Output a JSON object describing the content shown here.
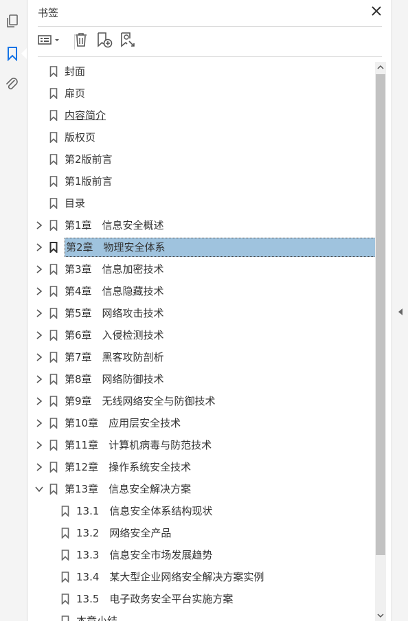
{
  "panel": {
    "title": "书签"
  },
  "toolbar": {
    "items": [
      {
        "name": "options-menu",
        "icon": "list-options-icon"
      },
      {
        "name": "delete",
        "icon": "trash-icon"
      },
      {
        "name": "new-bookmark",
        "icon": "bookmark-add-icon"
      },
      {
        "name": "find-bookmark",
        "icon": "bookmark-search-icon"
      }
    ]
  },
  "left_rail": {
    "items": [
      {
        "name": "pages",
        "icon": "pages-icon"
      },
      {
        "name": "bookmarks",
        "icon": "bookmark-icon",
        "active": true
      },
      {
        "name": "attachments",
        "icon": "paperclip-icon"
      }
    ]
  },
  "bookmarks": [
    {
      "label": "封面",
      "level": 0,
      "expand": "none"
    },
    {
      "label": "扉页",
      "level": 0,
      "expand": "none"
    },
    {
      "label": "内容简介",
      "level": 0,
      "expand": "none",
      "underline": true
    },
    {
      "label": "版权页",
      "level": 0,
      "expand": "none"
    },
    {
      "label": "第2版前言",
      "level": 0,
      "expand": "none"
    },
    {
      "label": "第1版前言",
      "level": 0,
      "expand": "none"
    },
    {
      "label": "目录",
      "level": 0,
      "expand": "none"
    },
    {
      "label": "第1章　信息安全概述",
      "level": 0,
      "expand": "collapsed"
    },
    {
      "label": "第2章　物理安全体系",
      "level": 0,
      "expand": "collapsed",
      "selected": true
    },
    {
      "label": "第3章　信息加密技术",
      "level": 0,
      "expand": "collapsed"
    },
    {
      "label": "第4章　信息隐藏技术",
      "level": 0,
      "expand": "collapsed"
    },
    {
      "label": "第5章　网络攻击技术",
      "level": 0,
      "expand": "collapsed"
    },
    {
      "label": "第6章　入侵检测技术",
      "level": 0,
      "expand": "collapsed"
    },
    {
      "label": "第7章　黑客攻防剖析",
      "level": 0,
      "expand": "collapsed"
    },
    {
      "label": "第8章　网络防御技术",
      "level": 0,
      "expand": "collapsed"
    },
    {
      "label": "第9章　无线网络安全与防御技术",
      "level": 0,
      "expand": "collapsed"
    },
    {
      "label": "第10章　应用层安全技术",
      "level": 0,
      "expand": "collapsed"
    },
    {
      "label": "第11章　计算机病毒与防范技术",
      "level": 0,
      "expand": "collapsed"
    },
    {
      "label": "第12章　操作系统安全技术",
      "level": 0,
      "expand": "collapsed"
    },
    {
      "label": "第13章　信息安全解决方案",
      "level": 0,
      "expand": "expanded"
    },
    {
      "label": "13.1　信息安全体系结构现状",
      "level": 1,
      "expand": "none"
    },
    {
      "label": "13.2　网络安全产品",
      "level": 1,
      "expand": "none"
    },
    {
      "label": "13.3　信息安全市场发展趋势",
      "level": 1,
      "expand": "none"
    },
    {
      "label": "13.4　某大型企业网络安全解决方案实例",
      "level": 1,
      "expand": "none"
    },
    {
      "label": "13.5　电子政务安全平台实施方案",
      "level": 1,
      "expand": "none"
    },
    {
      "label": "本章小结",
      "level": 1,
      "expand": "none"
    }
  ],
  "colors": {
    "selection_bg": "#9fc3de",
    "icon": "#555555",
    "active_icon": "#1473e6"
  }
}
